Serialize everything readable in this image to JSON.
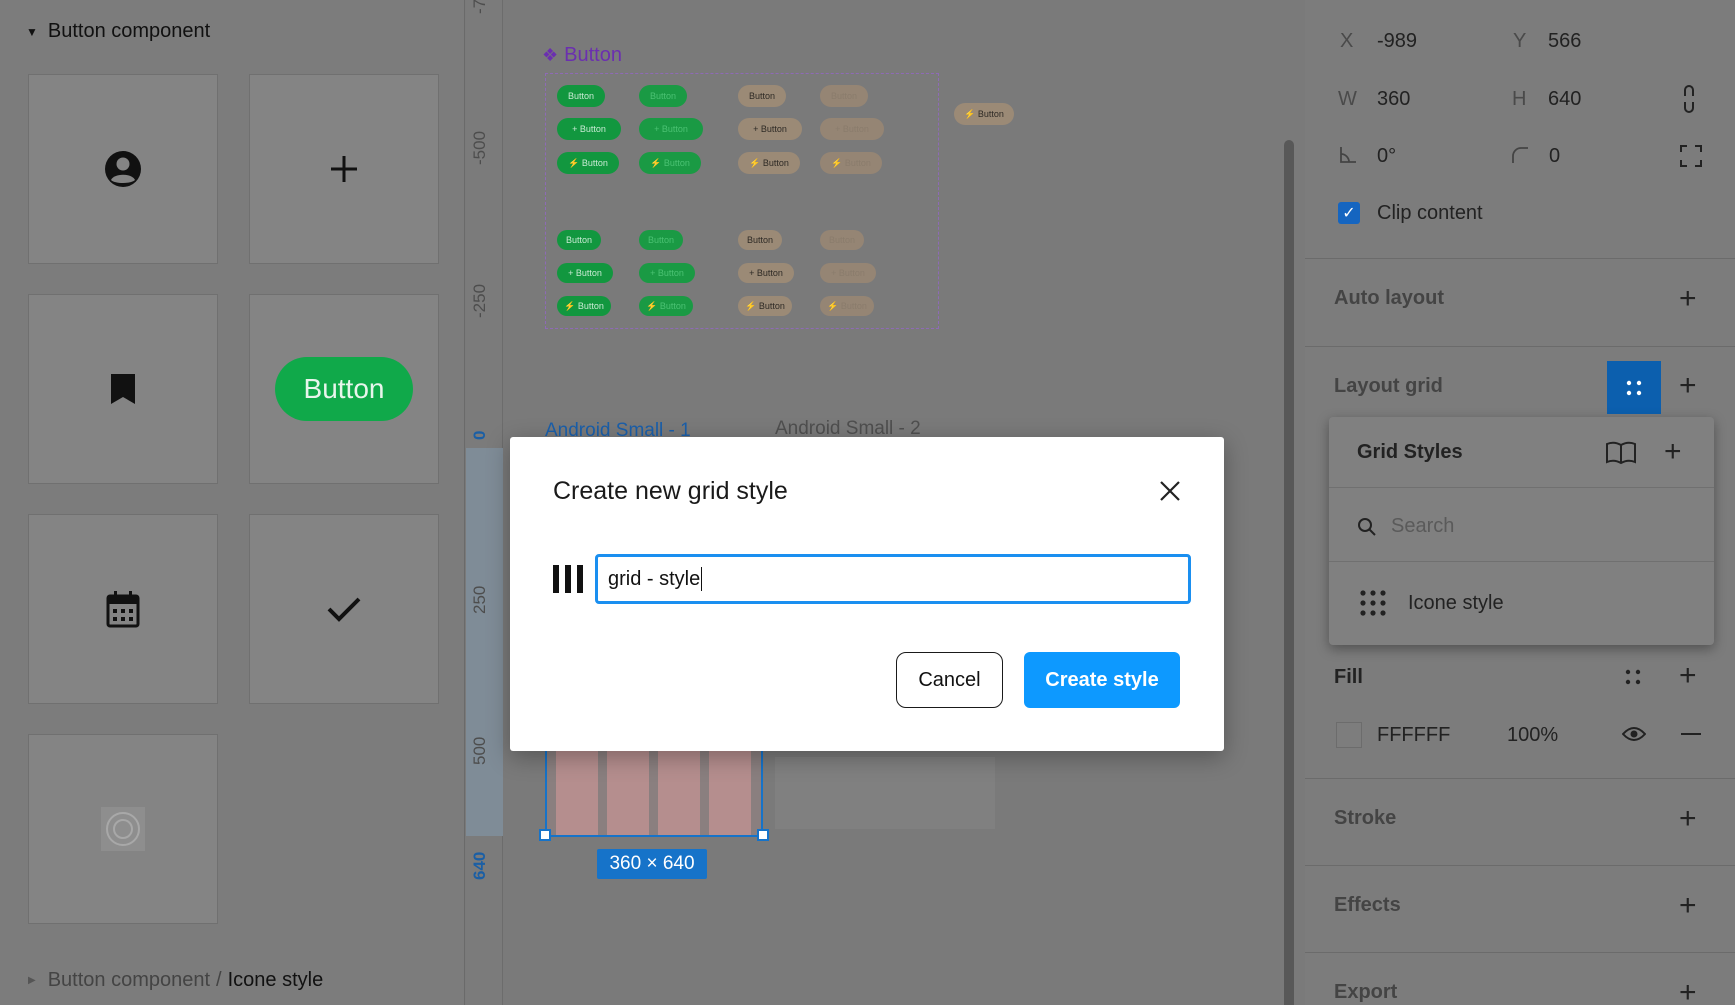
{
  "assets_panel": {
    "section_title": "Button component",
    "button_preview_label": "Button",
    "breadcrumb_parent": "Button component",
    "breadcrumb_separator": "/",
    "breadcrumb_current": "Icone style",
    "tiles": [
      "account-circle-icon",
      "plus-icon",
      "bookmark-icon",
      "button-component",
      "calendar-icon",
      "check-icon",
      "target-icon"
    ]
  },
  "ruler": {
    "labels": [
      "-7",
      "-500",
      "-250",
      "0",
      "250",
      "500"
    ],
    "highlight_label": "640"
  },
  "canvas": {
    "component_title": "Button",
    "pill_label": "Button",
    "plus_pill_label": "+ Button",
    "bolt_pill_label": "⚡ Button",
    "frame1_label": "Android Small - 1",
    "frame2_label": "Android Small - 2",
    "selection_size": "360 × 640"
  },
  "properties": {
    "x_label": "X",
    "x_value": "-989",
    "y_label": "Y",
    "y_value": "566",
    "w_label": "W",
    "w_value": "360",
    "h_label": "H",
    "h_value": "640",
    "rotation_value": "0°",
    "radius_value": "0",
    "clip_content_label": "Clip content",
    "auto_layout_label": "Auto layout",
    "layout_grid_label": "Layout grid",
    "fill_label": "Fill",
    "fill_hex": "FFFFFF",
    "fill_opacity": "100%",
    "stroke_label": "Stroke",
    "effects_label": "Effects",
    "export_label": "Export"
  },
  "grid_styles_popover": {
    "title": "Grid Styles",
    "search_placeholder": "Search",
    "items": [
      "Icone style"
    ]
  },
  "modal": {
    "title": "Create new grid style",
    "input_value": "grid - style",
    "cancel_label": "Cancel",
    "create_label": "Create style"
  },
  "colors": {
    "accent": "#0d99ff",
    "selection": "#1673c9",
    "component": "#6b2fb0",
    "button_green": "#10a94a"
  }
}
